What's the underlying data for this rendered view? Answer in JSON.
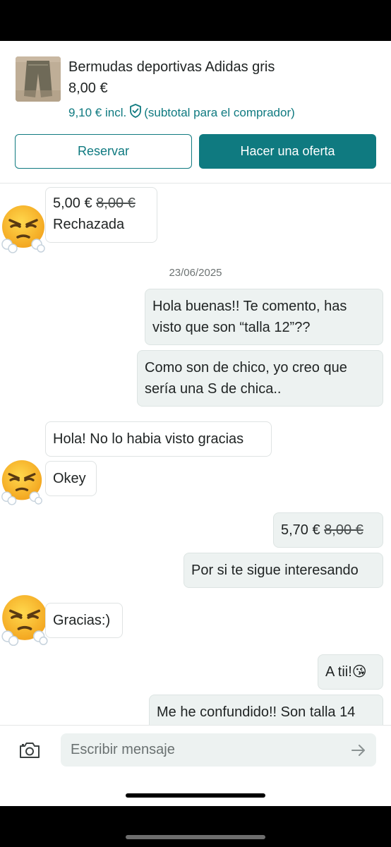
{
  "product": {
    "title": "Bermudas deportivas Adidas gris",
    "price": "8,00 €",
    "incl_price": "9,10 € incl.",
    "incl_note": "(subtotal para el comprador)",
    "reserve_label": "Reservar",
    "offer_label": "Hacer una oferta",
    "shield_icon": "shield-check-icon",
    "accent_color": "#0f7a80"
  },
  "chat": {
    "offer1": {
      "amount": "5,00 €",
      "original": "8,00 €",
      "status": "Rechazada"
    },
    "date": "23/06/2025",
    "msg1_line1": "Hola buenas!!  Te comento, has",
    "msg1_line2": "visto que son “talla 12”??",
    "msg2_line1": "Como son de chico, yo creo que",
    "msg2_line2": "sería una S de chica..",
    "msg3": "Hola! No lo habia visto gracias",
    "msg4": "Okey",
    "offer2": {
      "amount": "5,70 €",
      "original": "8,00 €"
    },
    "msg5": "Por si te sigue interesando",
    "msg6": "Gracias:)",
    "msg7": "A tii!😘",
    "msg8": "Me he confundido!! Son talla 14",
    "avatar_icon": "face-with-steam-emoji"
  },
  "composer": {
    "placeholder": "Escribir mensaje",
    "camera_icon": "camera-icon",
    "send_icon": "arrow-right-icon"
  }
}
